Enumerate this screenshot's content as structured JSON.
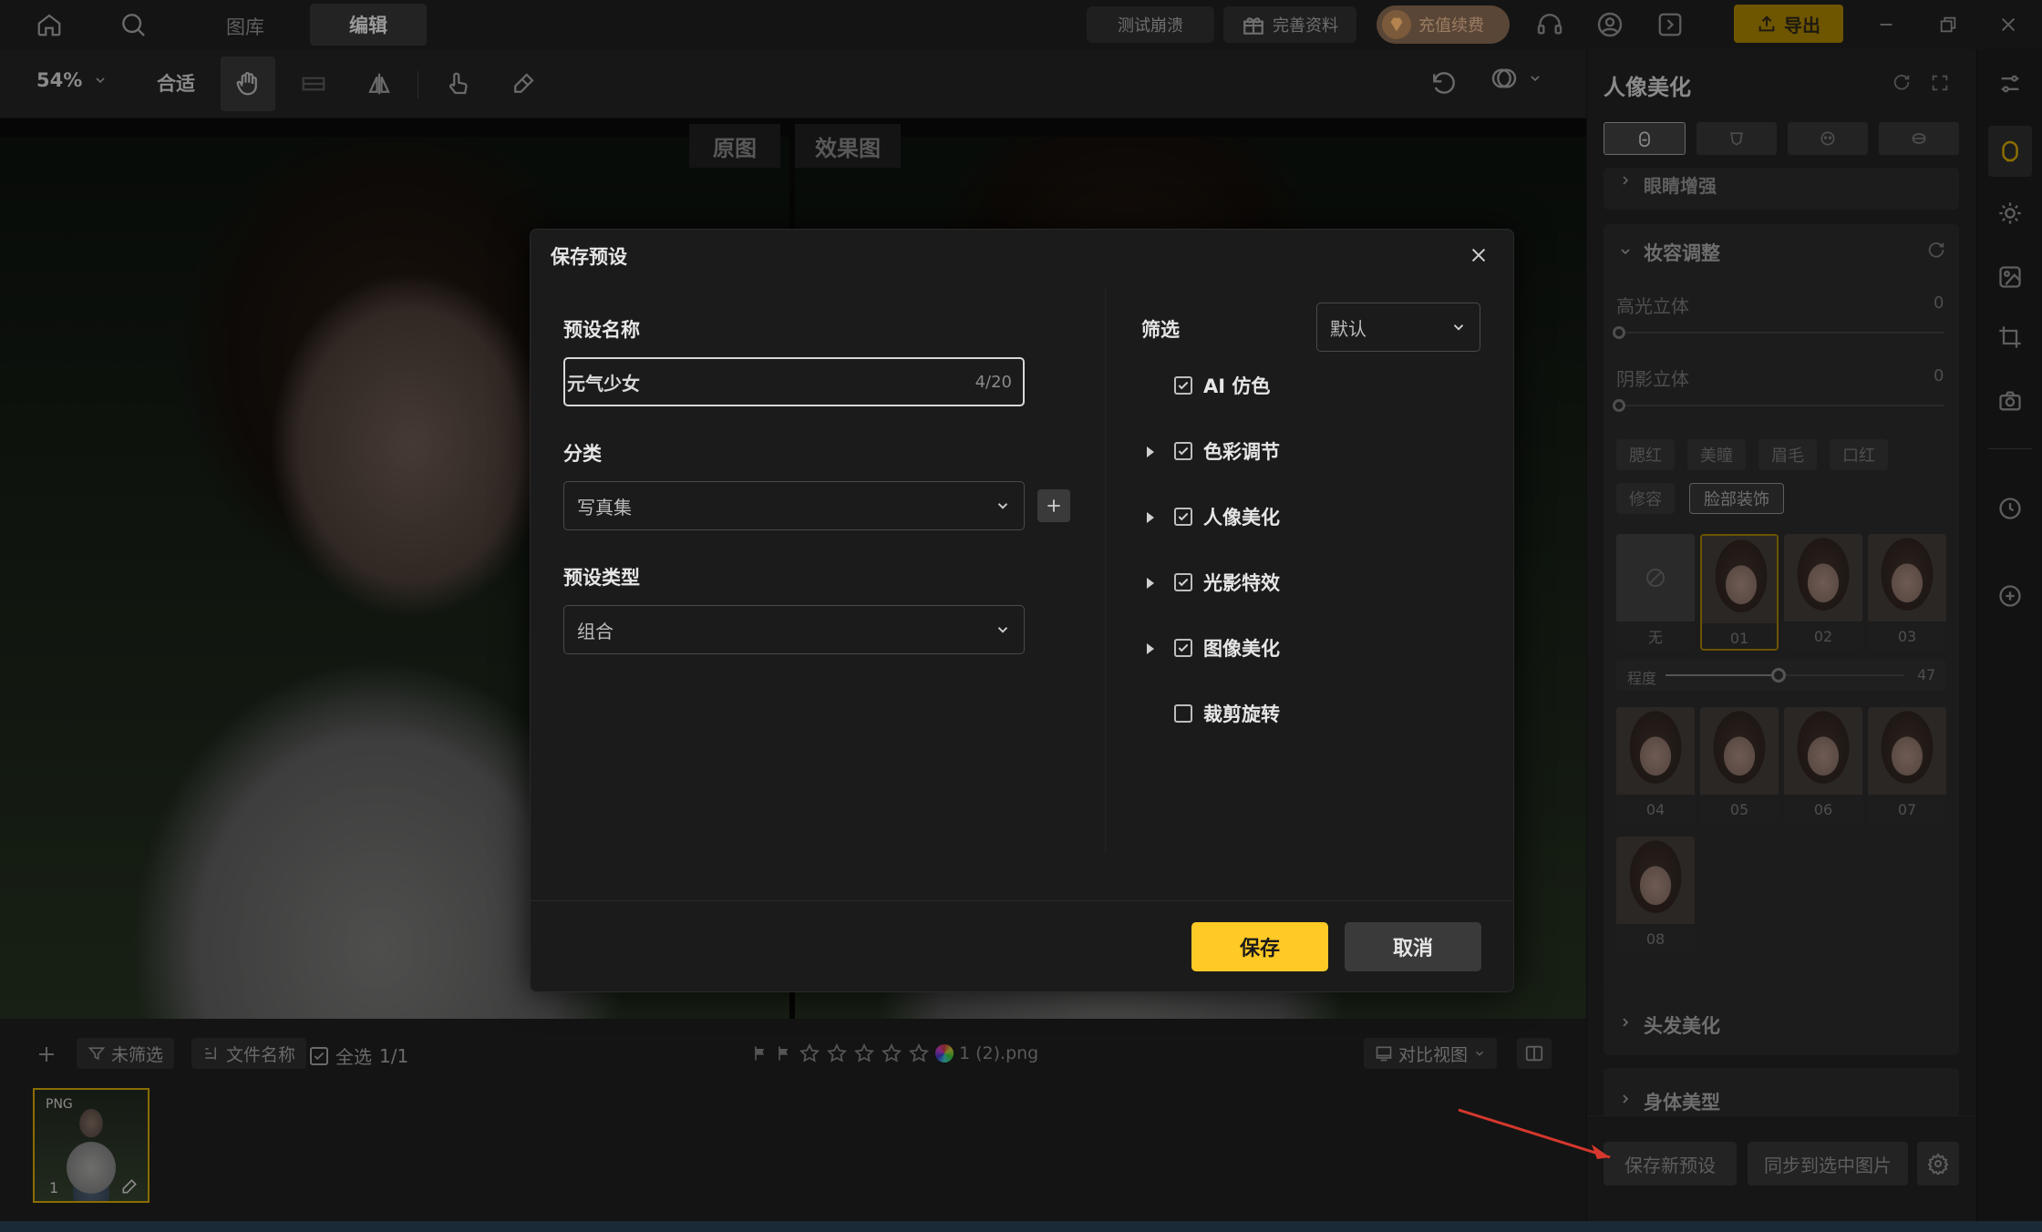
{
  "topbar": {
    "tab_library": "图库",
    "tab_edit": "编辑",
    "test_crash": "测试崩溃",
    "complete_info": "完善资料",
    "recharge": "充值续费",
    "export": "导出"
  },
  "toolbar": {
    "zoom": "54%",
    "fit": "合适"
  },
  "canvas": {
    "tab_original": "原图",
    "tab_effect": "效果图"
  },
  "bottombar": {
    "unfiltered": "未筛选",
    "filename": "文件名称",
    "select_all": "全选",
    "select_count": "1/1",
    "file_label": "1 (2).png",
    "compare_view": "对比视图"
  },
  "filmstrip": {
    "badge": "PNG",
    "index": "1"
  },
  "rpanel": {
    "title": "人像美化",
    "eye_enhance": "眼睛增强",
    "makeup_adjust": "妆容调整",
    "highlight": "高光立体",
    "highlight_value": "0",
    "shadow": "阴影立体",
    "shadow_value": "0",
    "chips": [
      "腮红",
      "美瞳",
      "眉毛",
      "口红",
      "修容",
      "脸部装饰"
    ],
    "thumbs_row1": [
      "无",
      "01",
      "02",
      "03"
    ],
    "degree_label": "程度",
    "degree_value": "47",
    "thumbs_row2": [
      "04",
      "05",
      "06",
      "07"
    ],
    "thumbs_row3": [
      "08"
    ],
    "hair_beauty": "头发美化",
    "body_shape": "身体美型",
    "save_new_preset": "保存新预设",
    "sync_to_selected": "同步到选中图片"
  },
  "dialog": {
    "title": "保存预设",
    "name_label": "预设名称",
    "name_value": "元气少女",
    "name_counter": "4/20",
    "category_label": "分类",
    "category_value": "写真集",
    "type_label": "预设类型",
    "type_value": "组合",
    "filter_label": "筛选",
    "filter_value": "默认",
    "options": [
      {
        "label": "AI 仿色",
        "checked": true,
        "expandable": false
      },
      {
        "label": "色彩调节",
        "checked": true,
        "expandable": true
      },
      {
        "label": "人像美化",
        "checked": true,
        "expandable": true
      },
      {
        "label": "光影特效",
        "checked": true,
        "expandable": true
      },
      {
        "label": "图像美化",
        "checked": true,
        "expandable": true
      },
      {
        "label": "裁剪旋转",
        "checked": false,
        "expandable": false
      }
    ],
    "save_button": "保存",
    "cancel_button": "取消"
  },
  "colors": {
    "accent": "#ffc926",
    "export_bg": "#6e5500",
    "dialog_bg": "#1b1b1b",
    "recharge_bg": "#5a4636"
  },
  "icons": [
    "home-icon",
    "search-icon",
    "gift-icon",
    "gem-icon",
    "headset-icon",
    "user-icon",
    "logout-icon",
    "export-icon",
    "minimize-icon",
    "restore-icon",
    "close-icon",
    "hand-icon",
    "flip-icon",
    "touch-icon",
    "eraser-icon",
    "undo-icon",
    "compare-icon",
    "chevron-down-icon",
    "plus-icon",
    "filter-icon",
    "sort-icon",
    "flag-icon",
    "star-icon",
    "color-wheel-icon",
    "split-view-icon",
    "refresh-icon",
    "fullscreen-icon",
    "face-icon",
    "sun-icon",
    "image-edit-icon",
    "crop-icon",
    "camera-icon",
    "history-icon",
    "add-circle-icon",
    "settings-icon",
    "slash-circle-icon",
    "pencil-icon",
    "checkbox-icon"
  ]
}
